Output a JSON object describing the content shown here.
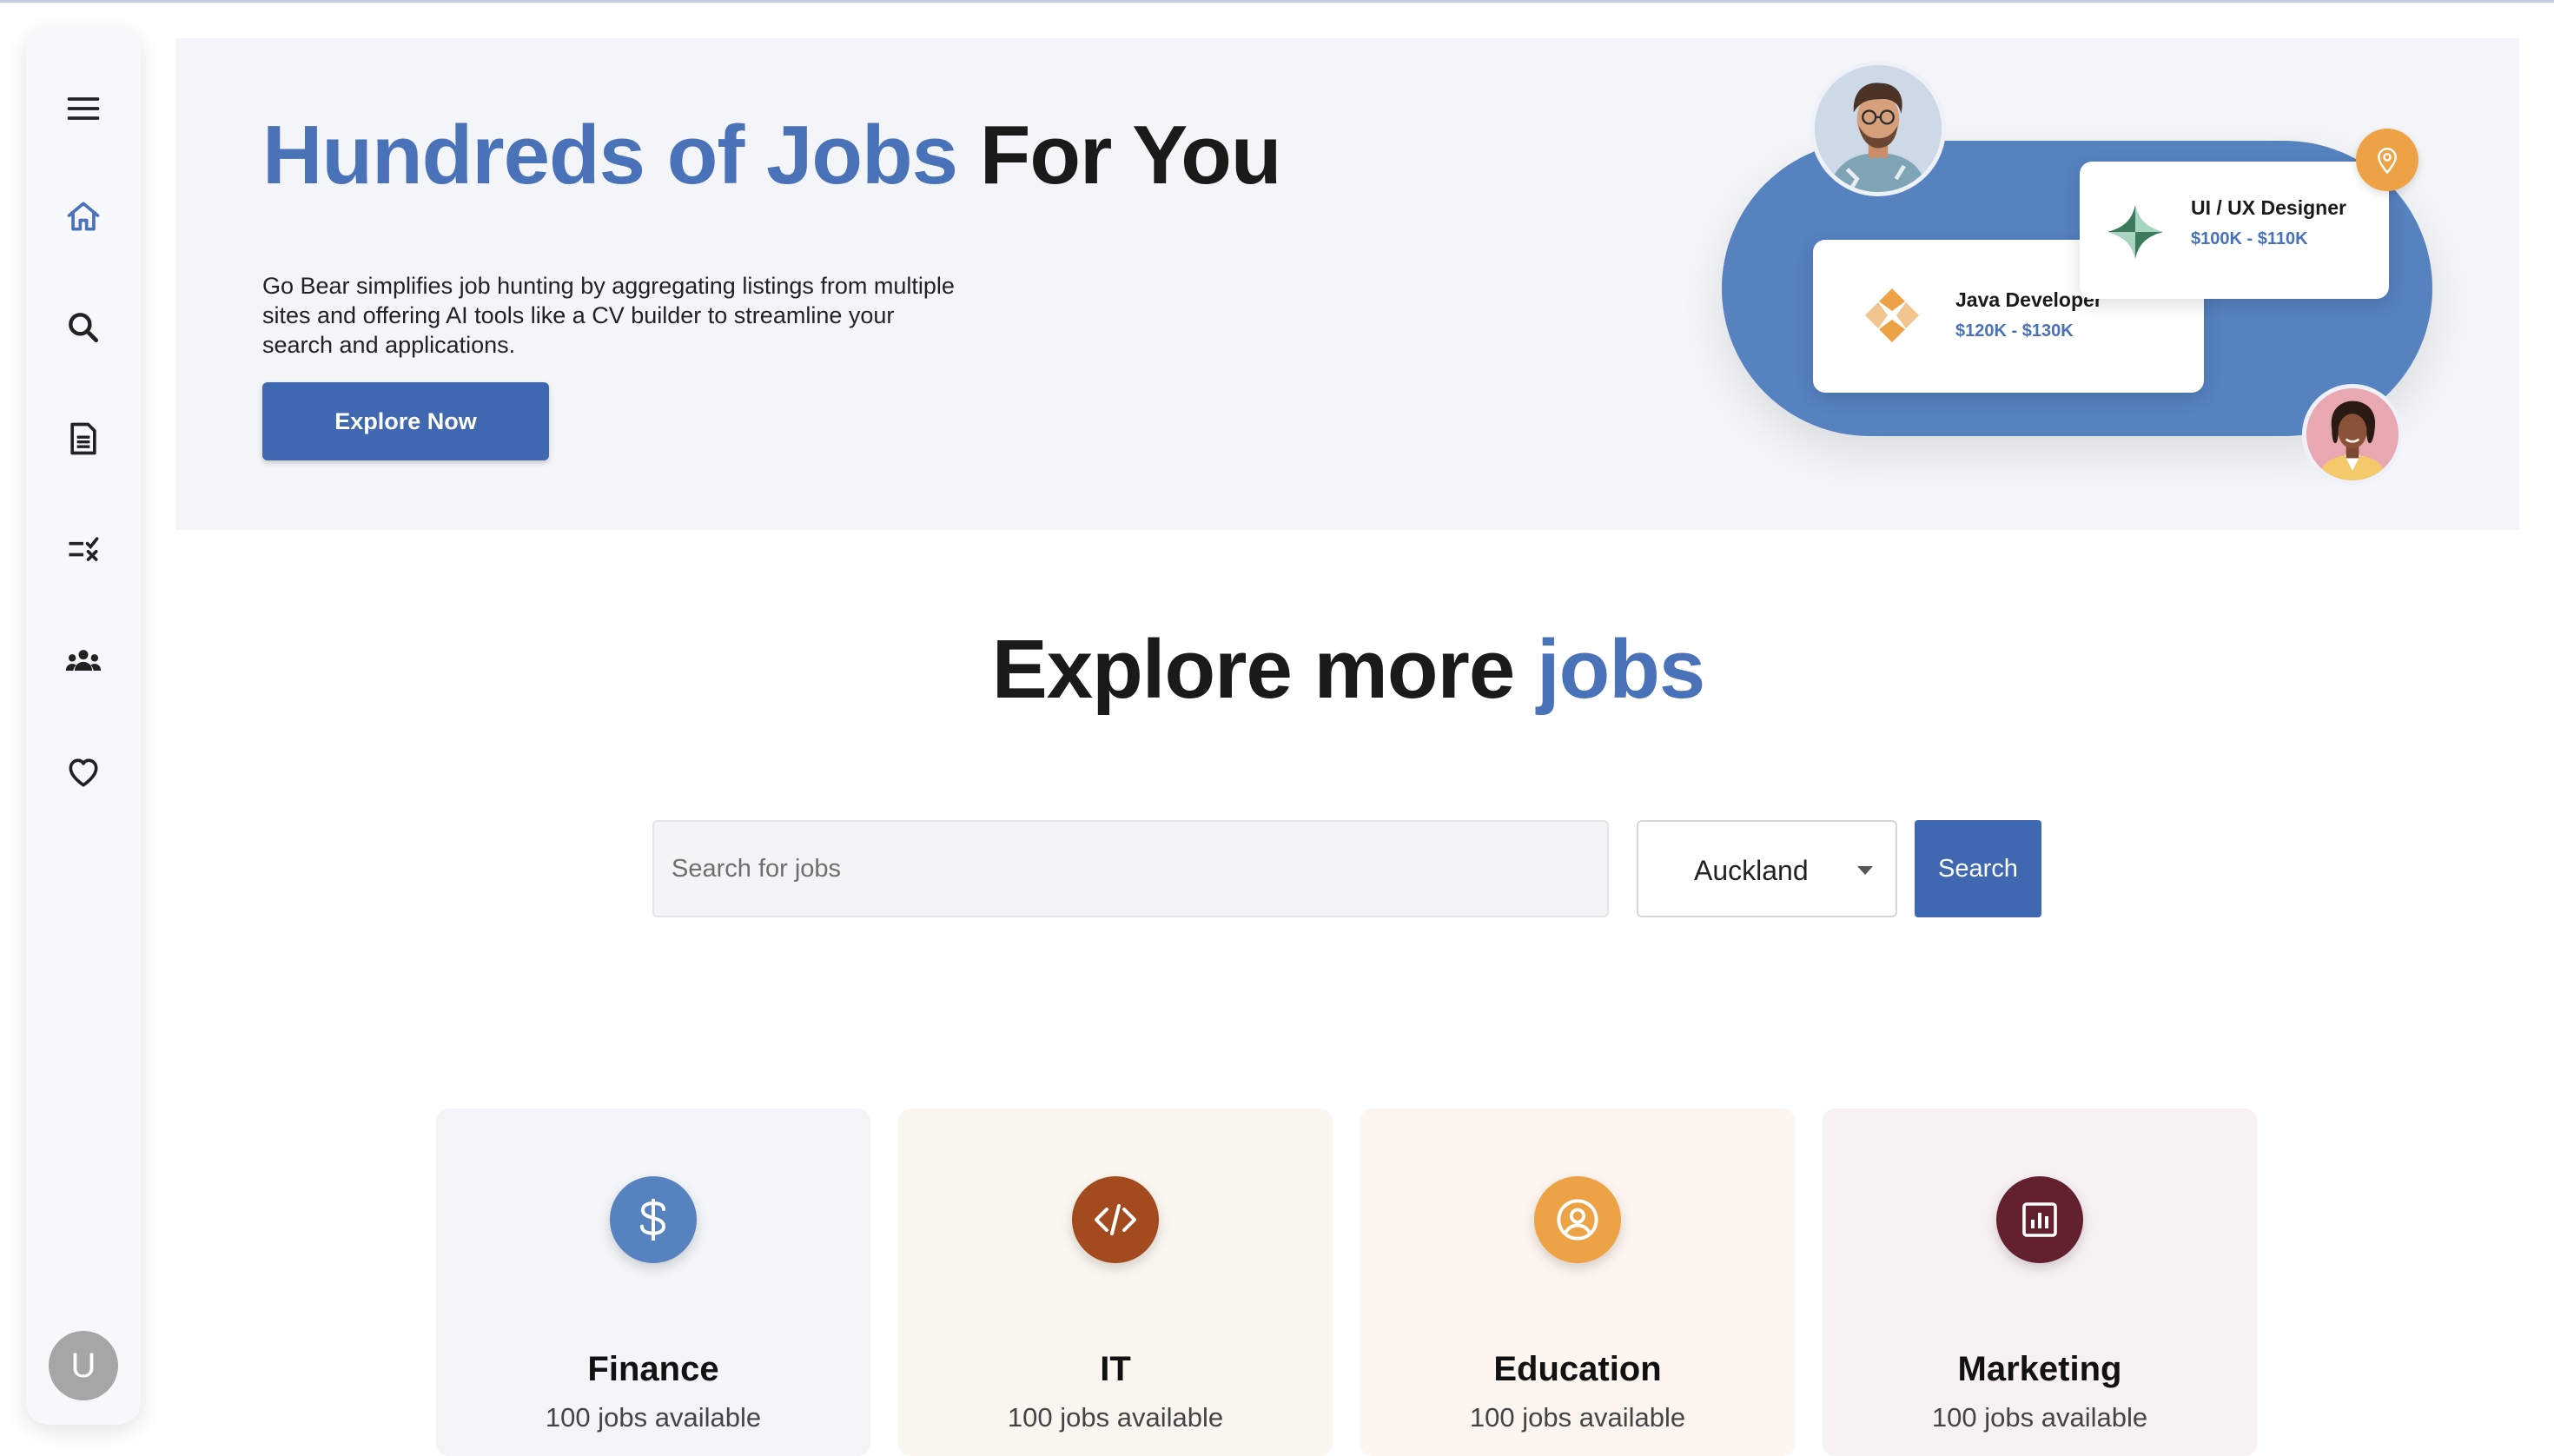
{
  "hero": {
    "title_accent": "Hundreds of Jobs",
    "title_rest": " For You",
    "description": "Go Bear simplifies job hunting by aggregating listings from multiple sites and offering AI tools like a CV builder to streamline your search and applications.",
    "explore_button": "Explore Now",
    "cards": [
      {
        "title": "Java Developer",
        "salary": "$120K - $130K"
      },
      {
        "title": "UI / UX Designer",
        "salary": "$100K - $110K"
      }
    ]
  },
  "sidebar": {
    "items": [
      {
        "icon": "menu-icon"
      },
      {
        "icon": "home-icon"
      },
      {
        "icon": "search-icon"
      },
      {
        "icon": "document-icon"
      },
      {
        "icon": "checklist-icon"
      },
      {
        "icon": "people-icon"
      },
      {
        "icon": "heart-icon"
      }
    ],
    "avatar_initial": "U"
  },
  "explore": {
    "heading_main": "Explore more ",
    "heading_accent": "jobs",
    "search_placeholder": "Search for jobs",
    "location": "Auckland",
    "search_button": "Search"
  },
  "categories": [
    {
      "name": "Finance",
      "count": "100 jobs available",
      "icon": "dollar-icon",
      "icon_color": "#5682c0",
      "bg": "#f3f5f9"
    },
    {
      "name": "IT",
      "count": "100 jobs available",
      "icon": "code-icon",
      "icon_color": "#a34a1e",
      "bg": "#fcf6f0"
    },
    {
      "name": "Education",
      "count": "100 jobs available",
      "icon": "user-circle-icon",
      "icon_color": "#eca245",
      "bg": "#fdf5ef"
    },
    {
      "name": "Marketing",
      "count": "100 jobs available",
      "icon": "chart-icon",
      "icon_color": "#62212c",
      "bg": "#f8f1f3"
    }
  ],
  "colors": {
    "brand": "#3f68b0",
    "accent_text": "#4a72b8",
    "sidebar_icon_active": "#4a72b8",
    "sidebar_icon": "#222222"
  }
}
